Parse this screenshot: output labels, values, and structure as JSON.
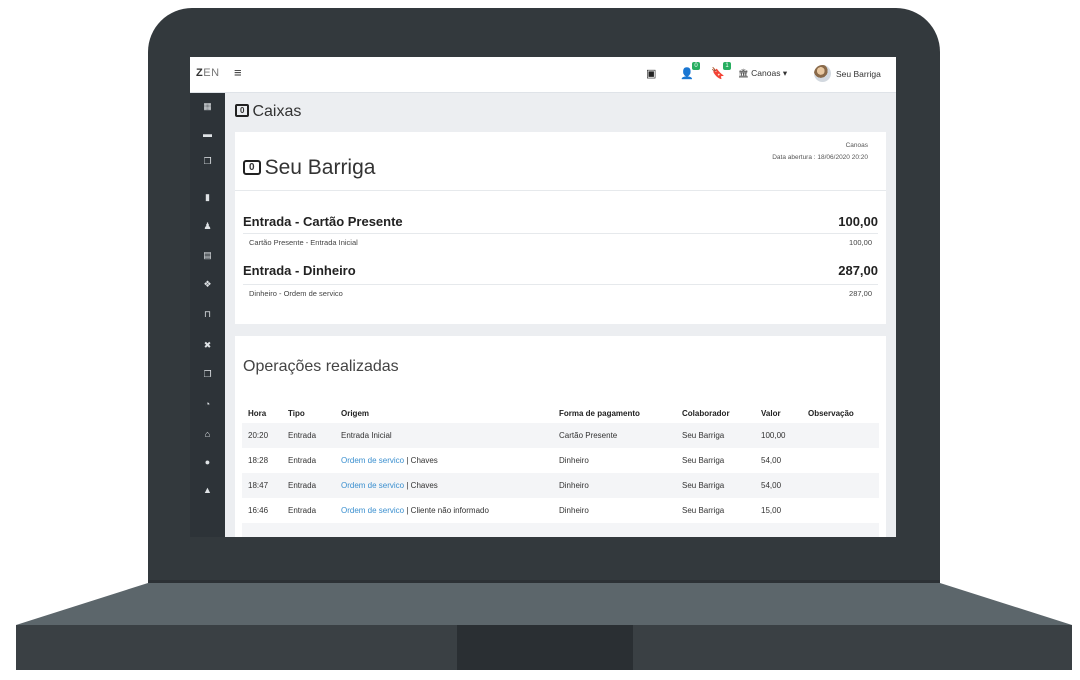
{
  "app": {
    "logo_bold": "Z",
    "logo_rest": "EN",
    "menu_icon": "hamburger-icon"
  },
  "topbar": {
    "notifications_badge": "0",
    "bookmarks_badge": "1",
    "location": "Canoas",
    "user": "Seu Barriga"
  },
  "sidebar": {
    "icons": [
      "calendar-icon",
      "money-icon",
      "copy-icon",
      "bookmark-icon",
      "user-icon",
      "building-icon",
      "cubes-icon",
      "flask-icon",
      "tools-icon",
      "copy-icon",
      "dashboard-icon",
      "bank-icon",
      "info-icon",
      "lock-icon"
    ]
  },
  "page": {
    "title": "Caixas"
  },
  "cashier": {
    "name": "Seu Barriga",
    "branch": "Canoas",
    "opened": "Data abertura : 18/06/2020 20:20",
    "entries": [
      {
        "title": "Entrada - Cartão Presente",
        "total": "100,00",
        "line": "Cartão Presente - Entrada Inicial",
        "line_value": "100,00"
      },
      {
        "title": "Entrada - Dinheiro",
        "total": "287,00",
        "line": "Dinheiro - Ordem de servico",
        "line_value": "287,00"
      }
    ]
  },
  "operations": {
    "title": "Operações realizadas",
    "headers": {
      "hora": "Hora",
      "tipo": "Tipo",
      "origem": "Origem",
      "forma": "Forma de pagamento",
      "colaborador": "Colaborador",
      "valor": "Valor",
      "obs": "Observação"
    },
    "rows": [
      {
        "hora": "20:20",
        "tipo": "Entrada",
        "origem_link": "",
        "origem_text": "Entrada Inicial",
        "forma": "Cartão Presente",
        "colaborador": "Seu Barriga",
        "valor": "100,00"
      },
      {
        "hora": "18:28",
        "tipo": "Entrada",
        "origem_link": "Ordem de servico",
        "origem_text": " | Chaves",
        "forma": "Dinheiro",
        "colaborador": "Seu Barriga",
        "valor": "54,00"
      },
      {
        "hora": "18:47",
        "tipo": "Entrada",
        "origem_link": "Ordem de servico",
        "origem_text": " | Chaves",
        "forma": "Dinheiro",
        "colaborador": "Seu Barriga",
        "valor": "54,00"
      },
      {
        "hora": "16:46",
        "tipo": "Entrada",
        "origem_link": "Ordem de servico",
        "origem_text": " | Cliente não informado",
        "forma": "Dinheiro",
        "colaborador": "Seu Barriga",
        "valor": "15,00"
      }
    ]
  },
  "colors": {
    "sidebar": "#2d3338",
    "link": "#3a8fcf",
    "badge": "#27ae60",
    "laptop": "#33393d"
  }
}
